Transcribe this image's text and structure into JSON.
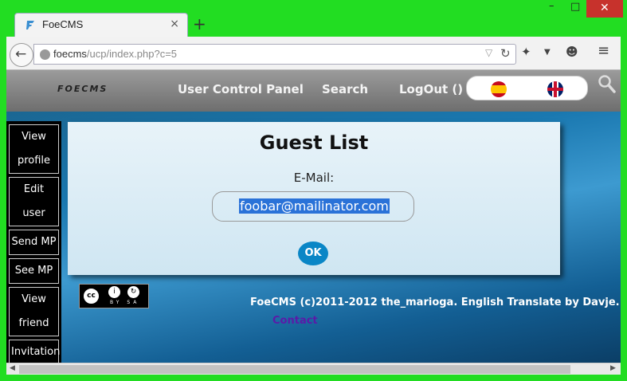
{
  "browser": {
    "tab_title": "FoeCMS",
    "tab_close": "×",
    "new_tab": "+",
    "url_host": "foecms",
    "url_path": "/ucp/index.php?c=5",
    "win_min": "–",
    "win_max": "□",
    "win_close": "✕"
  },
  "site": {
    "logo_text": "FOECMS",
    "nav": {
      "control_panel": "User Control Panel",
      "search": "Search",
      "logout": "LogOut ()"
    },
    "languages": [
      "es",
      "en"
    ]
  },
  "sidebar": {
    "items": [
      {
        "label": "View profile"
      },
      {
        "label": "Edit user"
      },
      {
        "label": "Send MP"
      },
      {
        "label": "See MP"
      },
      {
        "label": "View friend"
      },
      {
        "label": "Invitation"
      }
    ]
  },
  "panel": {
    "title": "Guest List",
    "email_label": "E-Mail:",
    "email_value": "foobar@mailinator.com",
    "ok_label": "OK"
  },
  "footer": {
    "copyright": "FoeCMS (c)2011-2012 the_marioga. English Translate by Davje.",
    "contact": "Contact",
    "cc_by": "BY SA"
  },
  "colors": {
    "frame": "#22dd22",
    "header": "#7a7a7a",
    "ok_button": "#0a86c6",
    "contact_link": "#5b1aa8"
  }
}
